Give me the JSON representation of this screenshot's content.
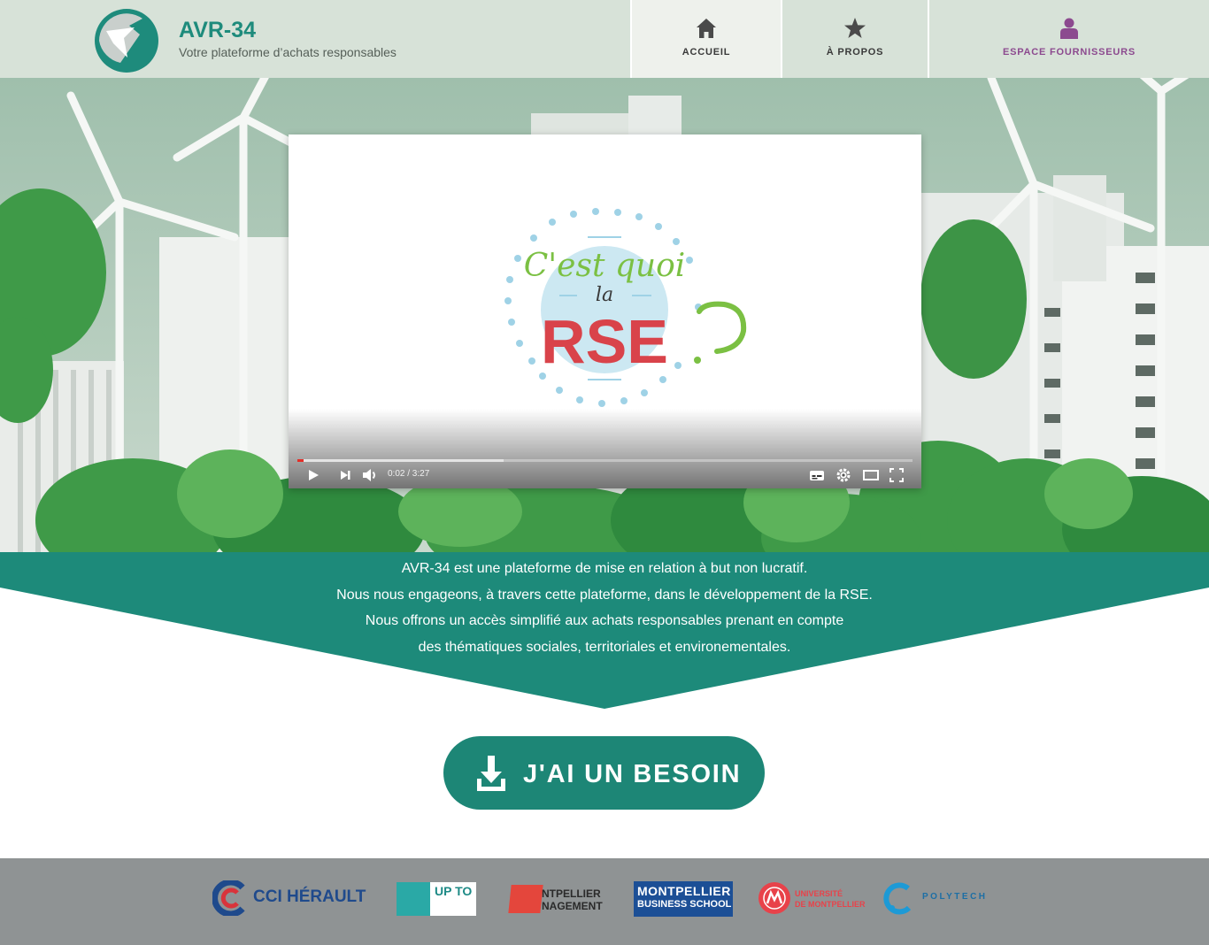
{
  "brand": {
    "title": "AVR-34",
    "subtitle": "Votre plateforme d’achats responsables"
  },
  "nav": [
    {
      "label": "ACCUEIL",
      "icon": "home-icon"
    },
    {
      "label": "À PROPOS",
      "icon": "star-icon"
    },
    {
      "label": "ESPACE FOURNISSEURS",
      "icon": "user-icon"
    }
  ],
  "video": {
    "poster_line1": "C'est quoi",
    "poster_line2": "la",
    "poster_line3": "RSE",
    "time": "0:02 / 3:27",
    "progress_fraction": 0.01,
    "buffered_fraction": 0.335
  },
  "banner": {
    "lines": [
      "AVR-34 est une plateforme de mise en relation à but non lucratif.",
      "Nous nous engageons, à travers cette plateforme, dans le développement de la RSE.",
      "Nous offrons un accès simplifié aux achats responsables prenant en compte",
      "des thématiques sociales, territoriales et environementales."
    ]
  },
  "cta": {
    "label": "J'AI UN BESOIN",
    "icon": "download-icon"
  },
  "partners": [
    {
      "name": "CCI HÉRAULT"
    },
    {
      "name": "UP TO"
    },
    {
      "name": "NTPELLIER",
      "name2": "NAGEMENT"
    },
    {
      "name": "MONTPELLIER",
      "name2": "BUSINESS SCHOOL"
    },
    {
      "name": "UNIVERSITÉ",
      "name2": "DE MONTPELLIER"
    },
    {
      "name": "POLYTECH"
    }
  ],
  "colors": {
    "teal": "#1d8a7a",
    "header_bg": "#d7e2d8",
    "purple": "#8c4a8f",
    "footer_bg": "#8f9394",
    "rse_red": "#d9434a",
    "rse_green": "#7bc043"
  }
}
